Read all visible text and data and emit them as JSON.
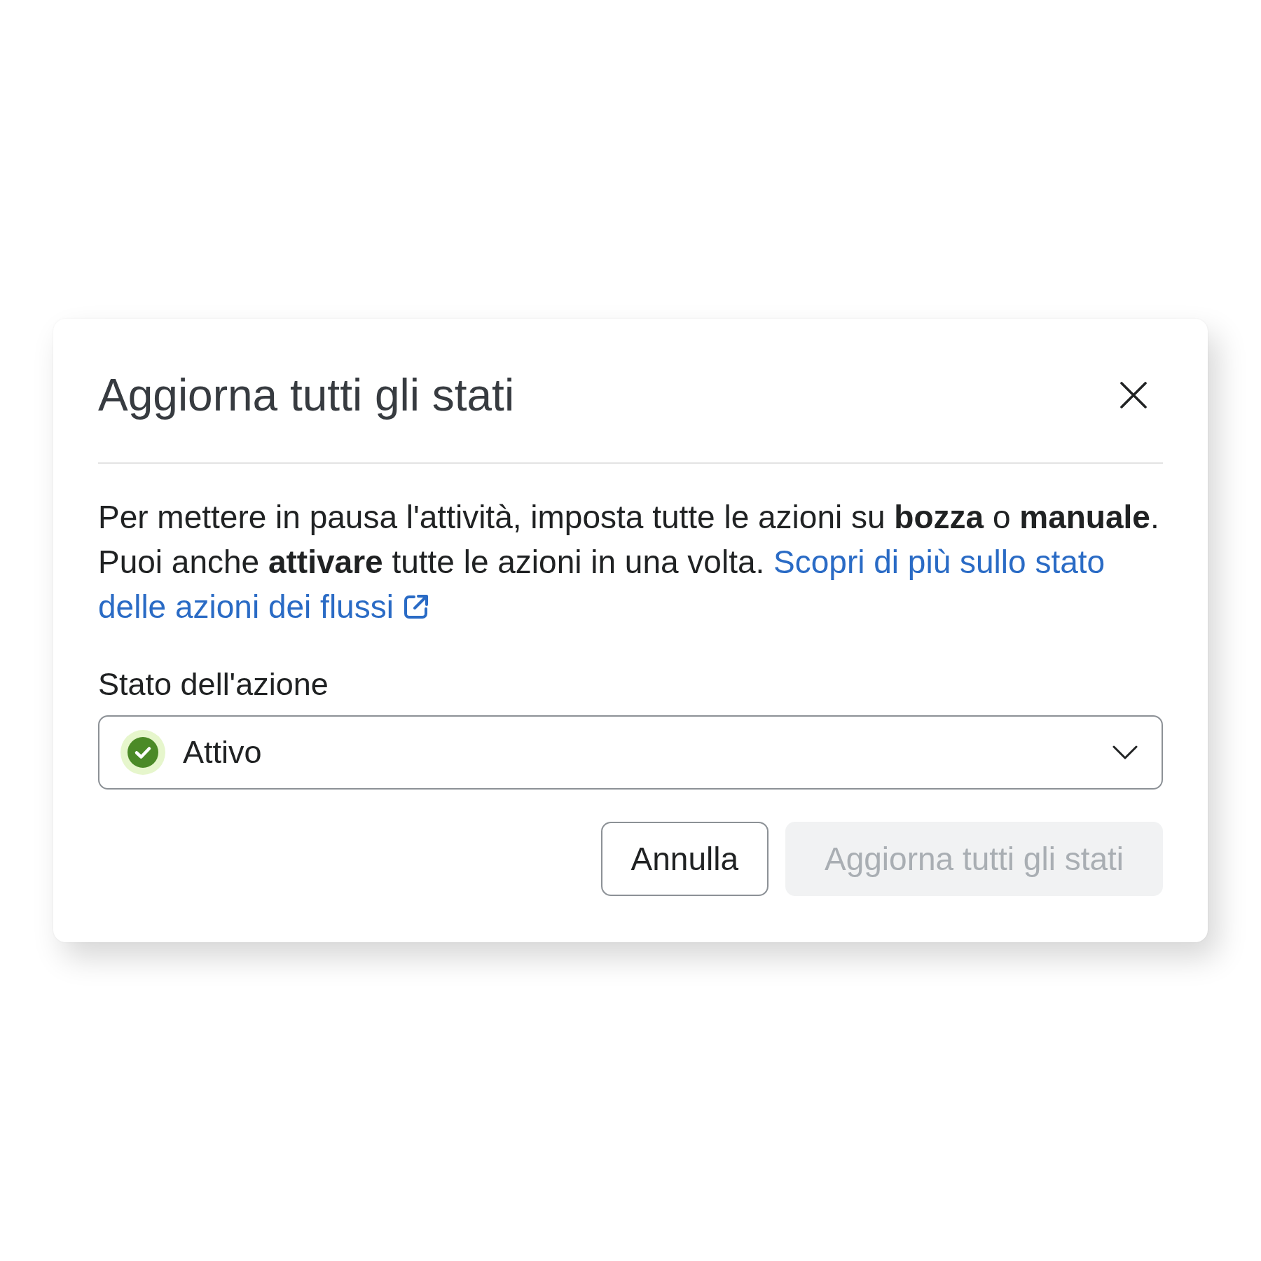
{
  "dialog": {
    "title": "Aggiorna tutti gli stati",
    "description": {
      "text": "Per mettere in pausa l'attività, imposta tutte le azioni su **bozza** o **manuale**. Puoi anche **attivare** tutte le azioni in una volta.",
      "link": {
        "lines": [
          "Scopri di più sullo stato",
          "delle azioni dei flussi"
        ],
        "external": true
      }
    },
    "field": {
      "label": "Stato dell'azione",
      "value": "Attivo"
    },
    "buttons": [
      {
        "label": "Annulla",
        "kind": "secondary",
        "disabled": false
      },
      {
        "label": "Aggiorna tutti gli stati",
        "kind": "primary",
        "disabled": true
      }
    ]
  }
}
